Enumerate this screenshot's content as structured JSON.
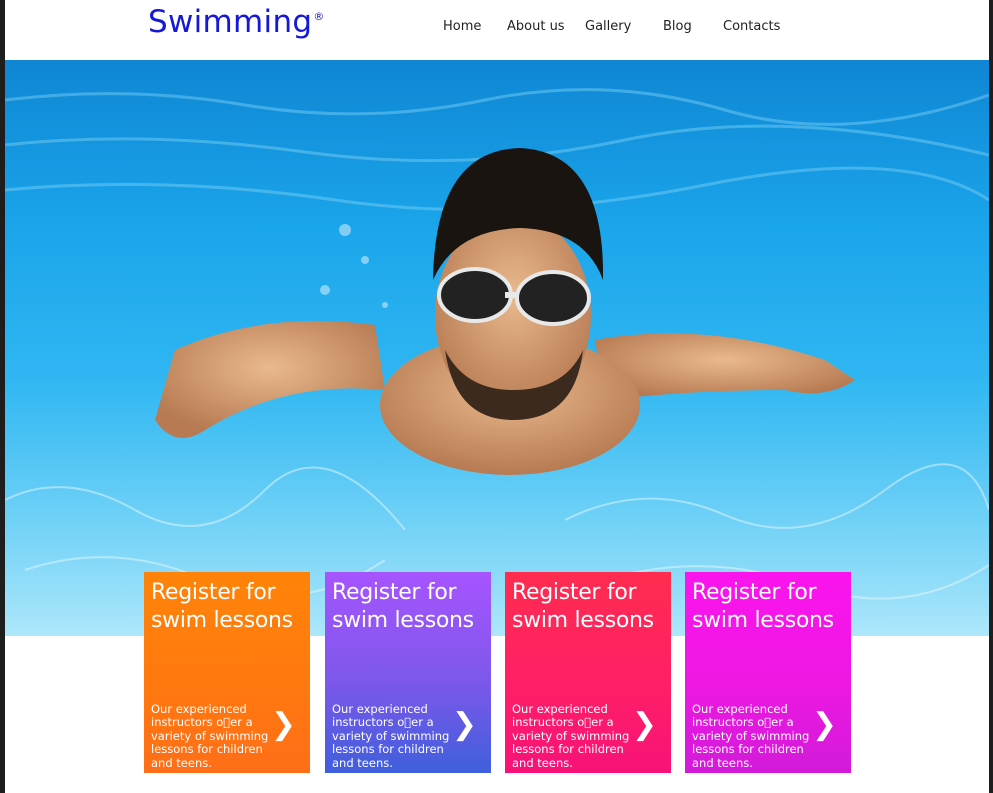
{
  "header": {
    "logo_text": "Swimming",
    "logo_mark": "®",
    "brand_color": "#1418d8",
    "nav": [
      {
        "label": "Home"
      },
      {
        "label": "About us"
      },
      {
        "label": "Gallery"
      },
      {
        "label": "Blog"
      },
      {
        "label": "Contacts"
      }
    ]
  },
  "hero": {
    "image": "underwater-swimmer-photo"
  },
  "cards": [
    {
      "title": "Register for swim lessons",
      "text": "Our experienced instructors o\u0000er a variety of swimming lessons for children and teens.",
      "arrow": "❯",
      "color": "#ff7a0e"
    },
    {
      "title": "Register for swim lessons",
      "text": "Our experienced instructors o\u0000er a variety of swimming lessons for children and teens.",
      "arrow": "❯",
      "color": "#8a55f0"
    },
    {
      "title": "Register for swim lessons",
      "text": "Our experienced instructors o\u0000er a variety of swimming lessons for children and teens.",
      "arrow": "❯",
      "color": "#ff2a5c"
    },
    {
      "title": "Register for swim lessons",
      "text": "Our experienced instructors o\u0000er a variety of swimming lessons for children and teens.",
      "arrow": "❯",
      "color": "#f01ee0"
    }
  ]
}
